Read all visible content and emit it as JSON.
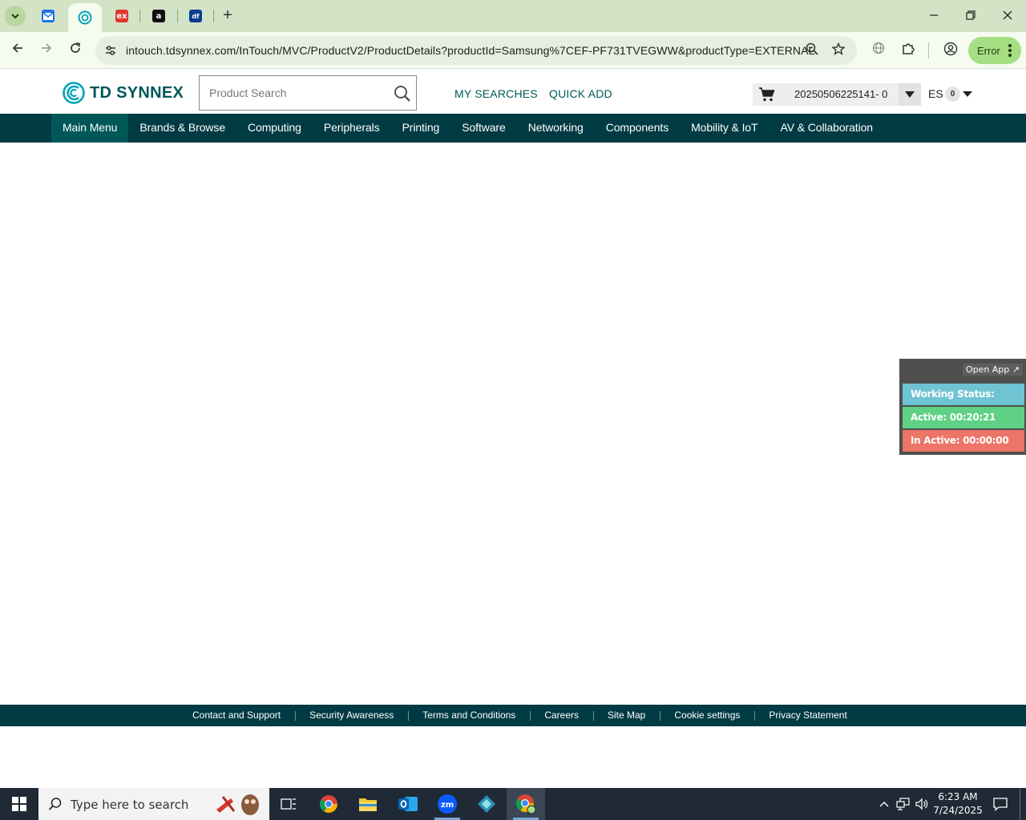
{
  "browser": {
    "tabs": [
      {
        "name": "tab-1",
        "favicon": "mail-favicon",
        "color": "#1a73e8"
      },
      {
        "name": "tab-2",
        "favicon": "td-synnex-favicon",
        "color": "#00a4b8",
        "active": true
      },
      {
        "name": "tab-3",
        "favicon": "ex-favicon",
        "color": "#e3342f"
      },
      {
        "name": "tab-4",
        "favicon": "amazon-favicon",
        "color": "#111111"
      },
      {
        "name": "tab-5",
        "favicon": "df-favicon",
        "color": "#0b3d91"
      }
    ],
    "url": "intouch.tdsynnex.com/InTouch/MVC/ProductV2/ProductDetails?productId=Samsung%7CEF-PF731TVEGWW&productType=EXTERNAL",
    "profile_status": "Error"
  },
  "site": {
    "logo_text": "TD SYNNEX",
    "search_placeholder": "Product Search",
    "links": {
      "my_searches": "MY SEARCHES",
      "quick_add": "QUICK ADD"
    },
    "cart_id": "20250506225141- 0",
    "language": "ES",
    "language_count": "0",
    "accent_color": "#005758",
    "nav_color": "#003b44"
  },
  "nav": {
    "items": [
      "Main Menu",
      "Brands & Browse",
      "Computing",
      "Peripherals",
      "Printing",
      "Software",
      "Networking",
      "Components",
      "Mobility & IoT",
      "AV & Collaboration"
    ]
  },
  "tracker": {
    "open_app": "Open App ↗",
    "status": "Working Status: Active",
    "active": "Active: 00:20:21",
    "inactive": "In Active: 00:00:00"
  },
  "footer": {
    "links": [
      "Contact and Support",
      "Security Awareness",
      "Terms and Conditions",
      "Careers",
      "Site Map",
      "Cookie settings",
      "Privacy Statement"
    ]
  },
  "taskbar": {
    "search_placeholder": "Type here to search",
    "time": "6:23 AM",
    "date": "7/24/2025"
  }
}
